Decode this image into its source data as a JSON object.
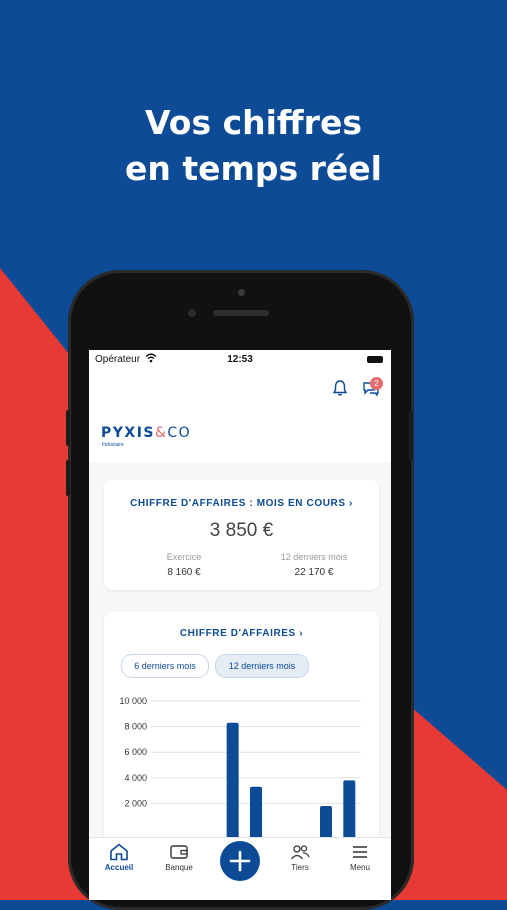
{
  "headline": {
    "line1": "Vos chiffres",
    "line2": "en temps réel"
  },
  "colors": {
    "blue": "#0d4b96",
    "red": "#e83a34",
    "accent_red": "#e36c6c"
  },
  "status_bar": {
    "carrier": "Opérateur",
    "time": "12:53"
  },
  "notifications": {
    "chat_badge": "2"
  },
  "logo": {
    "name": "PYXIS",
    "amp": "&",
    "suffix": "CO",
    "subtitle": "Fiduciaire"
  },
  "revenue_card": {
    "title": "CHIFFRE D'AFFAIRES : MOIS EN COURS  ›",
    "amount": "3 850 €",
    "stats": [
      {
        "label": "Exercice",
        "value": "8 160 €"
      },
      {
        "label": "12 derniers mois",
        "value": "22 170 €"
      }
    ]
  },
  "chart_card": {
    "title": "CHIFFRE D'AFFAIRES  ›",
    "filters": [
      "6 derniers mois",
      "12 derniers mois"
    ],
    "selected_filter": "12 derniers mois"
  },
  "chart_data": {
    "type": "bar",
    "yticks": [
      "10 000",
      "8 000",
      "6 000",
      "4 000",
      "2 000"
    ],
    "ylim": [
      0,
      10000
    ],
    "values": [
      0,
      0,
      0,
      8300,
      3300,
      0,
      0,
      1800,
      3800
    ],
    "grid": true
  },
  "tabbar": {
    "items": [
      {
        "label": "Accueil",
        "icon": "home-icon",
        "active": true
      },
      {
        "label": "Banque",
        "icon": "wallet-icon",
        "active": false
      },
      {
        "label": "Tiers",
        "icon": "people-icon",
        "active": false
      },
      {
        "label": "Menu",
        "icon": "hamburger-icon",
        "active": false
      }
    ],
    "fab_icon": "plus-icon"
  }
}
